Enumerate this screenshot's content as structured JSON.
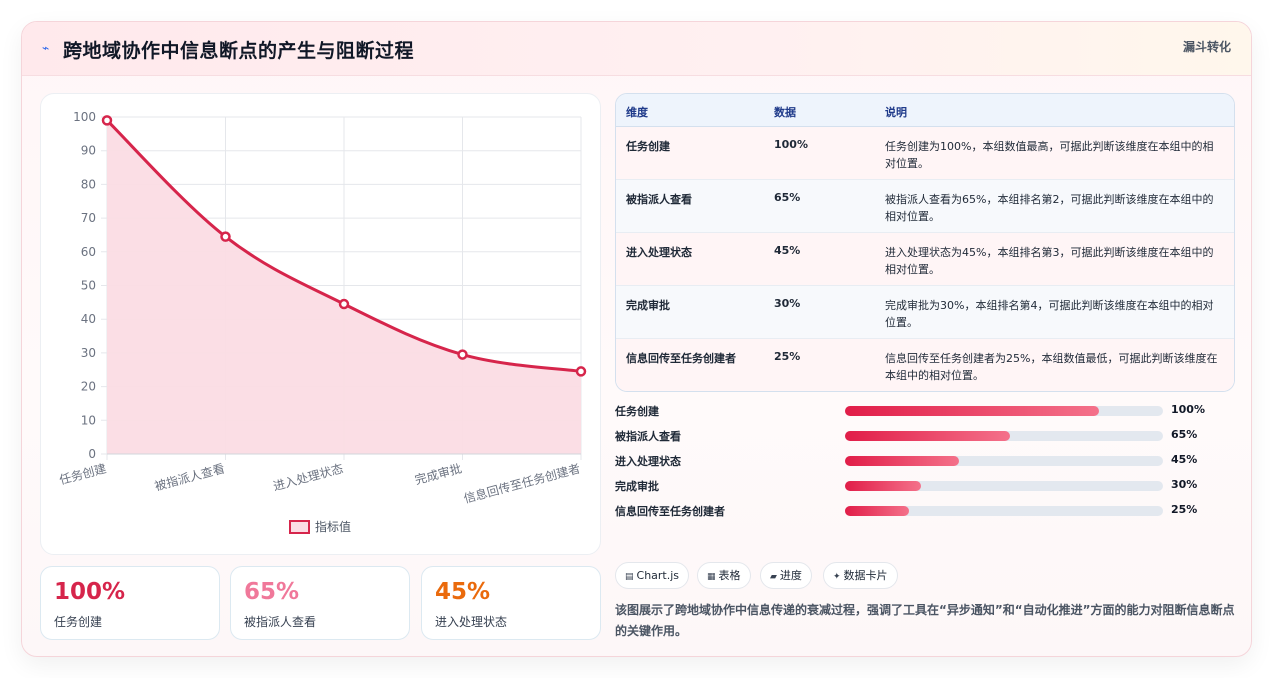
{
  "header": {
    "icon": "sparkle-icon",
    "title": "跨地域协作中信息断点的产生与阻断过程",
    "tag": "漏斗转化"
  },
  "colors": {
    "accent": "#d6254b",
    "fill": "#fbdce4",
    "stat1": "#d6254b",
    "stat2": "#f0789a",
    "stat3": "#ea6a0c"
  },
  "chart_data": {
    "type": "area",
    "categories": [
      "任务创建",
      "被指派人查看",
      "进入处理状态",
      "完成审批",
      "信息回传至任务创建者"
    ],
    "series": [
      {
        "name": "指标值",
        "values": [
          99,
          64.5,
          44.5,
          29.5,
          24.5
        ]
      }
    ],
    "ylim": [
      0,
      100
    ],
    "yticks": [
      0,
      10,
      20,
      30,
      40,
      50,
      60,
      70,
      80,
      90,
      100
    ],
    "grid": true,
    "legend": "bottom",
    "title": "",
    "xlabel": "",
    "ylabel": ""
  },
  "stats": [
    {
      "value": "100%",
      "label": "任务创建"
    },
    {
      "value": "65%",
      "label": "被指派人查看"
    },
    {
      "value": "45%",
      "label": "进入处理状态"
    }
  ],
  "table": {
    "headers": [
      "维度",
      "数据",
      "说明"
    ],
    "rows": [
      {
        "name": "任务创建",
        "value": "100%",
        "desc": "任务创建为100%，本组数值最高，可据此判断该维度在本组中的相对位置。"
      },
      {
        "name": "被指派人查看",
        "value": "65%",
        "desc": "被指派人查看为65%，本组排名第2，可据此判断该维度在本组中的相对位置。"
      },
      {
        "name": "进入处理状态",
        "value": "45%",
        "desc": "进入处理状态为45%，本组排名第3，可据此判断该维度在本组中的相对位置。"
      },
      {
        "name": "完成审批",
        "value": "30%",
        "desc": "完成审批为30%，本组排名第4，可据此判断该维度在本组中的相对位置。"
      },
      {
        "name": "信息回传至任务创建者",
        "value": "25%",
        "desc": "信息回传至任务创建者为25%，本组数值最低，可据此判断该维度在本组中的相对位置。"
      }
    ]
  },
  "bars": [
    {
      "label": "任务创建",
      "percent": 80,
      "value": "100%"
    },
    {
      "label": "被指派人查看",
      "percent": 52,
      "value": "65%"
    },
    {
      "label": "进入处理状态",
      "percent": 36,
      "value": "45%"
    },
    {
      "label": "完成审批",
      "percent": 24,
      "value": "30%"
    },
    {
      "label": "信息回传至任务创建者",
      "percent": 20,
      "value": "25%"
    }
  ],
  "chips": [
    {
      "icon": "chart-icon",
      "glyph": "▤",
      "label": "Chart.js"
    },
    {
      "icon": "table-icon",
      "glyph": "▦",
      "label": "表格"
    },
    {
      "icon": "progress-icon",
      "glyph": "▰",
      "label": "进度"
    },
    {
      "icon": "card-icon",
      "glyph": "✦",
      "label": "数据卡片"
    }
  ],
  "note": "该图展示了跨地域协作中信息传递的衰减过程，强调了工具在“异步通知”和“自动化推进”方面的能力对阻断信息断点的关键作用。"
}
